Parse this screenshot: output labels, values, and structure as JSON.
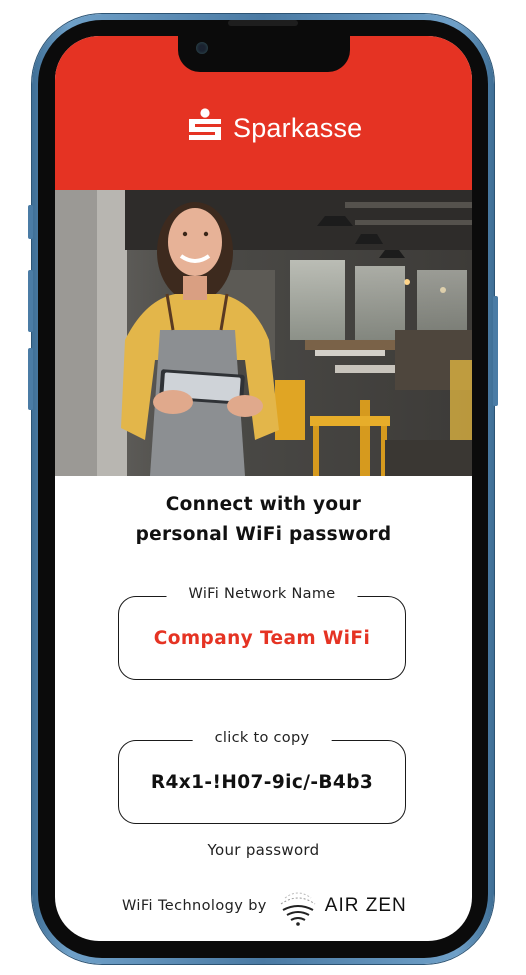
{
  "brand": {
    "name": "Sparkasse",
    "color": "#e53323"
  },
  "hero": {
    "alt": "Smiling waitress holding a tablet in a cafe"
  },
  "headline": {
    "line1": "Connect with your",
    "line2": "personal WiFi password"
  },
  "network": {
    "label": "WiFi Network Name",
    "value": "Company Team WiFi",
    "value_color": "#e53323"
  },
  "password": {
    "label": "click to copy",
    "value": "R4x1-!H07-9ic/-B4b3",
    "caption": "Your password"
  },
  "footer": {
    "text": "WiFi Technology by",
    "provider": "AIR ZEN"
  }
}
